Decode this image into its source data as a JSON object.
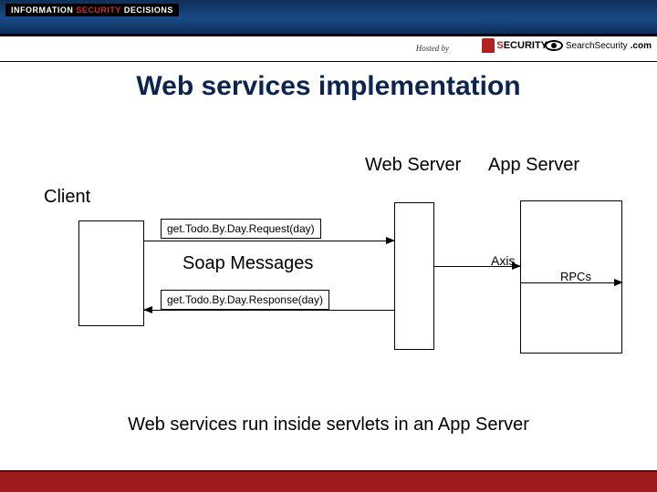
{
  "header": {
    "badge_prefix": "INFORMATION",
    "badge_mid": "SECURITY",
    "badge_suffix": "DECISIONS",
    "hosted_by": "Hosted by",
    "security_s": "S",
    "security_rest": "ECURITY",
    "search_text": "SearchSecurity",
    "search_suffix": ".com"
  },
  "slide": {
    "title": "Web services implementation",
    "caption": "Web services run inside servlets in an App Server"
  },
  "diagram": {
    "client_label": "Client",
    "web_server_label": "Web Server",
    "app_server_label": "App Server",
    "request_text": "get.Todo.By.Day.Request(day)",
    "response_text": "get.Todo.By.Day.Response(day)",
    "center_label": "Soap Messages",
    "axis_label": "Axis",
    "rpc_label": "RPCs"
  }
}
